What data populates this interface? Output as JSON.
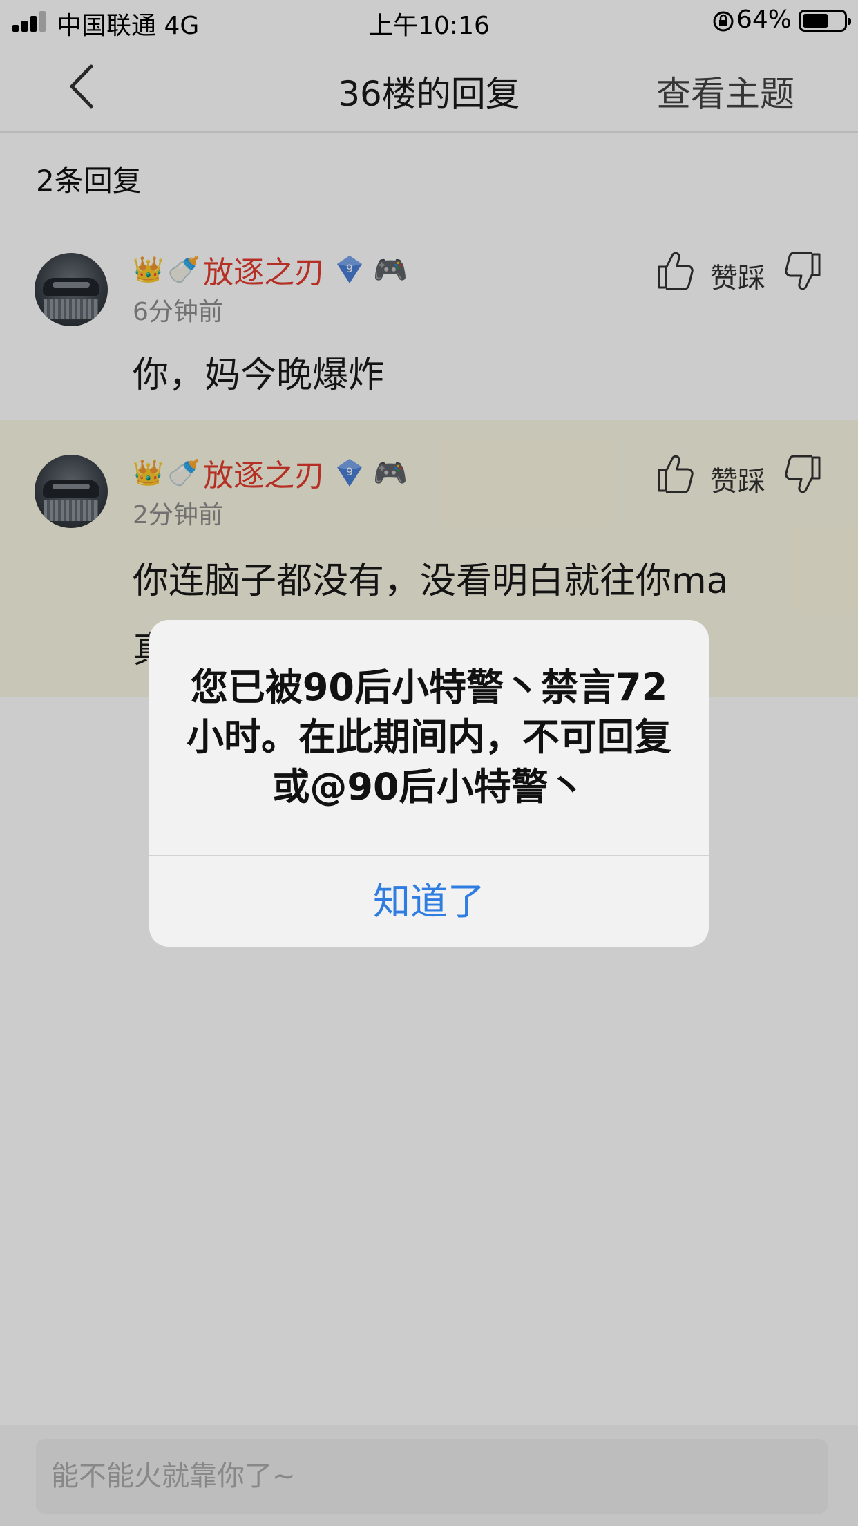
{
  "status_bar": {
    "carrier": "中国联通 4G",
    "time": "上午10:16",
    "battery_percent": "64%",
    "battery_level": 0.64
  },
  "nav": {
    "title": "36楼的回复",
    "action": "查看主题"
  },
  "reply_count": "2条回复",
  "replies": [
    {
      "username": "放逐之刃",
      "level": "9",
      "time_ago": "6分钟前",
      "text": "你，妈今晚爆炸",
      "vote_label": "赞踩",
      "highlighted": false
    },
    {
      "username": "放逐之刃",
      "level": "9",
      "time_ago": "2分钟前",
      "text": "你连脑子都没有，没看明白就往你ma",
      "text_line2": "真",
      "vote_label": "赞踩",
      "highlighted": true
    }
  ],
  "input": {
    "placeholder": "能不能火就靠你了~"
  },
  "alert": {
    "message": "您已被90后小特警丶禁言72小时。在此期间内，不可回复或@90后小特警丶",
    "button": "知道了"
  },
  "colors": {
    "username": "#e33b2e",
    "alert_button": "#2f7de1",
    "highlight_bg": "#fbf8e4"
  }
}
